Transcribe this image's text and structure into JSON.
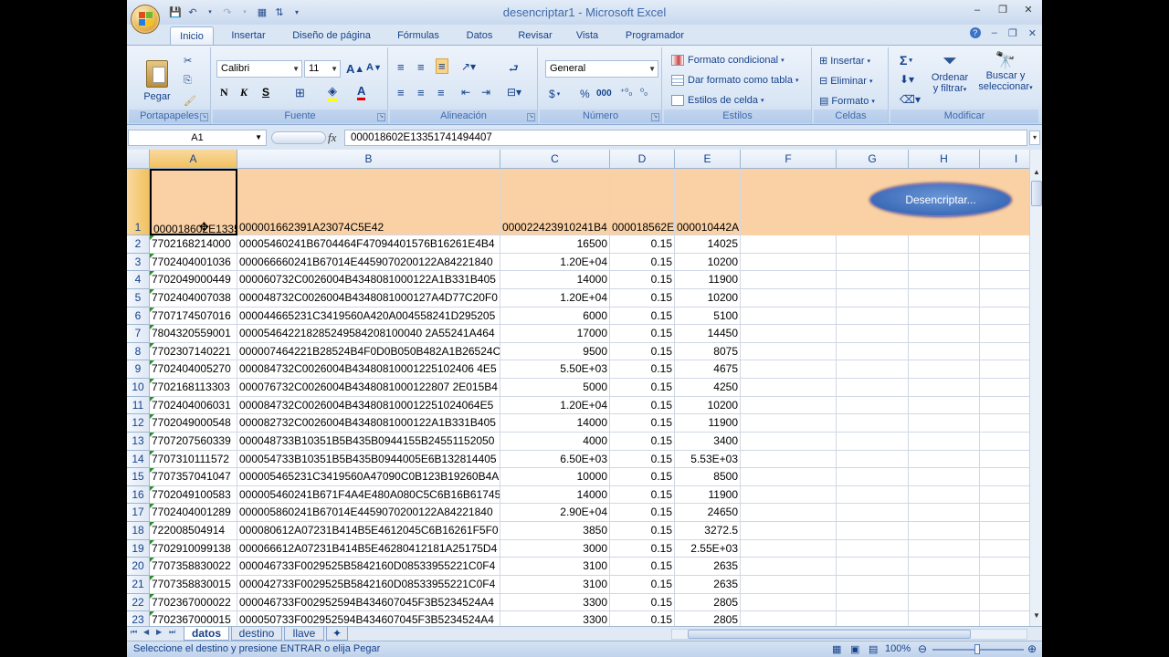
{
  "title": "desencriptar1 - Microsoft Excel",
  "window_controls": {
    "minimize": "–",
    "restore": "❐",
    "close": "✕"
  },
  "doc_controls": {
    "help": "?",
    "minimize": "–",
    "restore": "❐",
    "close": "✕"
  },
  "tabs": [
    "Inicio",
    "Insertar",
    "Diseño de página",
    "Fórmulas",
    "Datos",
    "Revisar",
    "Vista",
    "Programador"
  ],
  "ribbon": {
    "portapapeles": {
      "label": "Portapapeles",
      "paste": "Pegar"
    },
    "fuente": {
      "label": "Fuente",
      "font": "Calibri",
      "size": "11",
      "bold": "N",
      "italic": "K",
      "underline": "S"
    },
    "alineacion": {
      "label": "Alineación"
    },
    "numero": {
      "label": "Número",
      "format": "General",
      "currency": "$",
      "percent": "%",
      "thousands": "000"
    },
    "estilos": {
      "label": "Estilos",
      "conditional": "Formato condicional",
      "table": "Dar formato como tabla",
      "cell_styles": "Estilos de celda"
    },
    "celdas": {
      "label": "Celdas",
      "insert": "Insertar",
      "delete": "Eliminar",
      "format": "Formato"
    },
    "modificar": {
      "label": "Modificar",
      "sort_1": "Ordenar",
      "sort_2": "y filtrar",
      "find_1": "Buscar y",
      "find_2": "seleccionar",
      "sigma": "Σ"
    }
  },
  "formula_bar": {
    "name_box": "A1",
    "fx": "fx",
    "value": "000018602E13351741494407"
  },
  "columns": [
    "A",
    "B",
    "C",
    "D",
    "E",
    "F",
    "G",
    "H",
    "I"
  ],
  "header_row": {
    "a": "000018602E13351741494407",
    "b": "000001662391A23074C5E42",
    "c": "000022423910241B4",
    "d": "000018562E",
    "e": "000010442A"
  },
  "button": {
    "label": "Desencriptar..."
  },
  "rows": [
    {
      "n": "2",
      "a": "7702168214000",
      "b": "00005460241B6704464F47094401576B16261E4B4",
      "c": "16500",
      "d": "0.15",
      "e": "14025"
    },
    {
      "n": "3",
      "a": "7702404001036",
      "b": "000066660241B67014E4459070200122A84221840",
      "c": "1.20E+04",
      "d": "0.15",
      "e": "10200"
    },
    {
      "n": "4",
      "a": "7702049000449",
      "b": "000060732C0026004B4348081000122A1B331B405",
      "c": "14000",
      "d": "0.15",
      "e": "11900"
    },
    {
      "n": "5",
      "a": "7702404007038",
      "b": "000048732C0026004B4348081000127A4D77C20F0",
      "c": "1.20E+04",
      "d": "0.15",
      "e": "10200"
    },
    {
      "n": "6",
      "a": "7707174507016",
      "b": "000044665231C3419560A420A004558241D295205",
      "c": "6000",
      "d": "0.15",
      "e": "5100"
    },
    {
      "n": "7",
      "a": "7804320559001",
      "b": "000054642218285249584208100040 2A55241A464",
      "c": "17000",
      "d": "0.15",
      "e": "14450"
    },
    {
      "n": "8",
      "a": "7702307140221",
      "b": "000007464221B28524B4F0D0B050B482A1B26524C",
      "c": "9500",
      "d": "0.15",
      "e": "8075"
    },
    {
      "n": "9",
      "a": "7702404005270",
      "b": "000084732C0026004B43480810001225102406 4E5",
      "c": "5.50E+03",
      "d": "0.15",
      "e": "4675"
    },
    {
      "n": "10",
      "a": "7702168113303",
      "b": "000076732C0026004B4348081000122807 2E015B4",
      "c": "5000",
      "d": "0.15",
      "e": "4250"
    },
    {
      "n": "11",
      "a": "7702404006031",
      "b": "000084732C0026004B434808100012251024064E5",
      "c": "1.20E+04",
      "d": "0.15",
      "e": "10200"
    },
    {
      "n": "12",
      "a": "7702049000548",
      "b": "000082732C0026004B4348081000122A1B331B405",
      "c": "14000",
      "d": "0.15",
      "e": "11900"
    },
    {
      "n": "13",
      "a": "7707207560339",
      "b": "000048733B10351B5B435B0944155B24551152050",
      "c": "4000",
      "d": "0.15",
      "e": "3400"
    },
    {
      "n": "14",
      "a": "7707310111572",
      "b": "000054733B10351B5B435B0944005E6B132814405",
      "c": "6.50E+03",
      "d": "0.15",
      "e": "5.53E+03"
    },
    {
      "n": "15",
      "a": "7707357041047",
      "b": "000005465231C3419560A47090C0B123B19260B4A",
      "c": "10000",
      "d": "0.15",
      "e": "8500"
    },
    {
      "n": "16",
      "a": "7702049100583",
      "b": "000005460241B671F4A4E480A080C5C6B16B61745",
      "c": "14000",
      "d": "0.15",
      "e": "11900"
    },
    {
      "n": "17",
      "a": "7702404001289",
      "b": "000005860241B67014E4459070200122A84221840",
      "c": "2.90E+04",
      "d": "0.15",
      "e": "24650"
    },
    {
      "n": "18",
      "a": "722008504914",
      "b": "000080612A07231B414B5E4612045C6B16261F5F0",
      "c": "3850",
      "d": "0.15",
      "e": "3272.5"
    },
    {
      "n": "19",
      "a": "7702910099138",
      "b": "000066612A07231B414B5E46280412181A25175D4",
      "c": "3000",
      "d": "0.15",
      "e": "2.55E+03"
    },
    {
      "n": "20",
      "a": "7707358830022",
      "b": "000046733F0029525B5842160D08533955221C0F4",
      "c": "3100",
      "d": "0.15",
      "e": "2635"
    },
    {
      "n": "21",
      "a": "7707358830015",
      "b": "000042733F0029525B5842160D08533955221C0F4",
      "c": "3100",
      "d": "0.15",
      "e": "2635"
    },
    {
      "n": "22",
      "a": "7702367000022",
      "b": "000046733F002952594B434607045F3B5234524A4",
      "c": "3300",
      "d": "0.15",
      "e": "2805"
    },
    {
      "n": "23",
      "a": "7702367000015",
      "b": "000050733F002952594B434607045F3B5234524A4",
      "c": "3300",
      "d": "0.15",
      "e": "2805"
    }
  ],
  "sheets": [
    "datos",
    "destino",
    "llave"
  ],
  "status": {
    "message": "Seleccione el destino y presione ENTRAR o elija Pegar",
    "zoom": "100%"
  }
}
